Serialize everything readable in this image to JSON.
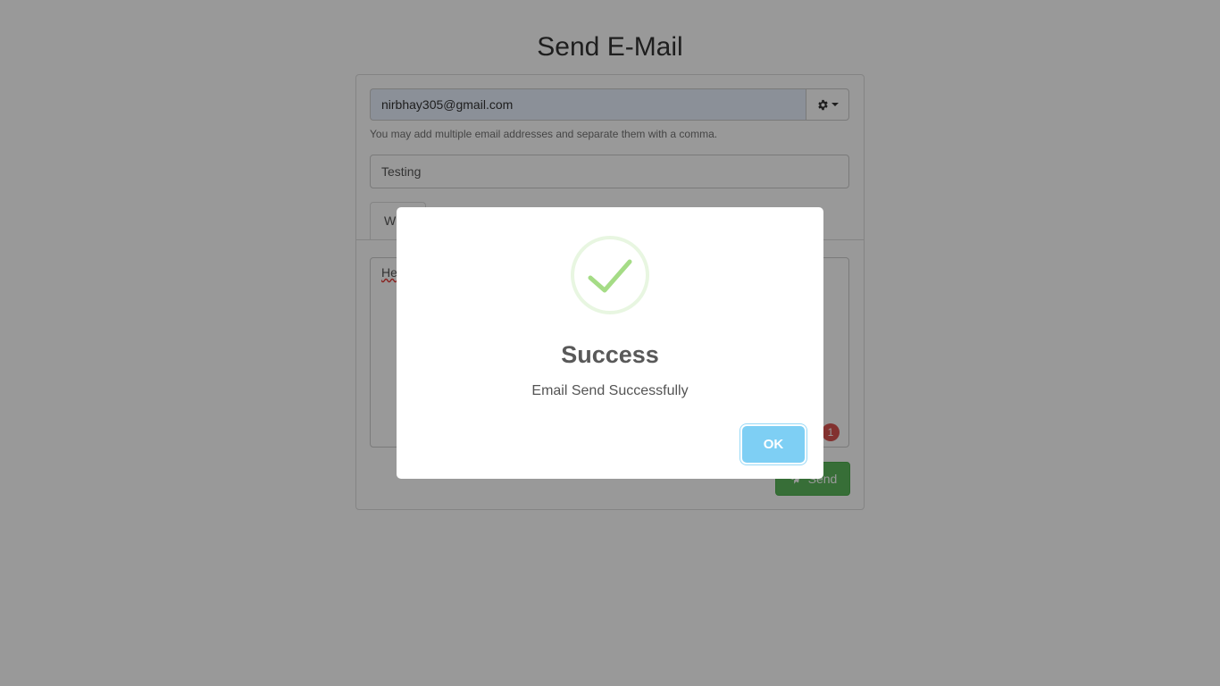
{
  "page": {
    "title": "Send E-Mail"
  },
  "form": {
    "to_value": "nirbhay305@gmail.com",
    "help_text": "You may add multiple email addresses and separate them with a comma.",
    "subject_value": "Testing",
    "active_tab_label": "W",
    "body_value": "He",
    "badge_count": "1",
    "send_label": "Send",
    "settings_icon": "gear-icon"
  },
  "modal": {
    "title": "Success",
    "message": "Email Send Successfully",
    "ok_label": "OK",
    "icon": "success-check-icon"
  },
  "colors": {
    "overlay": "rgba(0,0,0,0.4)",
    "success_green": "#a5dc86",
    "ok_button": "#7ecff4",
    "send_button": "#5cb85c",
    "badge": "#d9534f"
  }
}
